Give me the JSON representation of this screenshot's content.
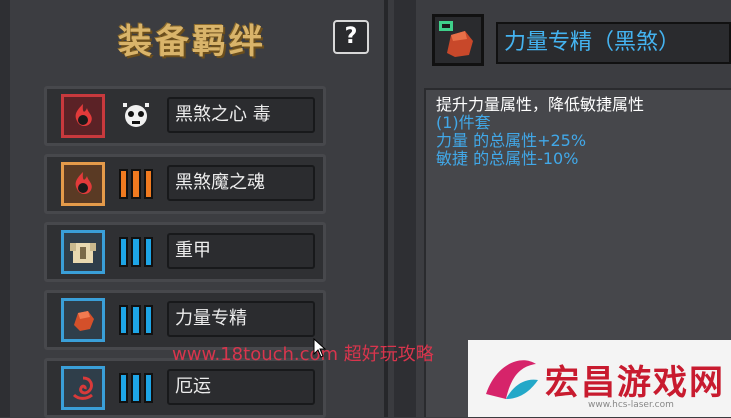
{
  "panel": {
    "title": "装备羁绊",
    "help_label": "?"
  },
  "sets": [
    {
      "name": "黑煞之心 毒",
      "count_color": "#d8d8d8",
      "icon": "black-flame-icon",
      "border_color": "#c8393d",
      "icon_bg": "#5b2226"
    },
    {
      "name": "黑煞魔之魂",
      "count_color": "#f07a20",
      "icon": "black-flame-icon",
      "border_color": "#e49a4a",
      "icon_bg": "#5a3a24"
    },
    {
      "name": "重甲",
      "count_color": "#1ea5e6",
      "icon": "heavy-armor-icon",
      "border_color": "#3a9fd8",
      "icon_bg": "#2f3e4a"
    },
    {
      "name": "力量专精",
      "count_color": "#1ea5e6",
      "icon": "strength-fist-icon",
      "border_color": "#3a9fd8",
      "icon_bg": "#2f3e4a"
    },
    {
      "name": "厄运",
      "count_color": "#1ea5e6",
      "icon": "doom-swirl-icon",
      "border_color": "#3a9fd8",
      "icon_bg": "#2f3e4a"
    }
  ],
  "detail": {
    "item_name": "力量专精（黑煞）",
    "item_icon": "strength-fist-icon",
    "description": "提升力量属性，降低敏捷属性",
    "set_count": "(1)件套",
    "stats": [
      "力量 的总属性+25%",
      "敏捷 的总属性-10%"
    ]
  },
  "watermark": {
    "url_text": "www.18touch.com 超好玩攻略",
    "logo_text": "宏昌游戏网",
    "logo_sub": "www.hcs-laser.com"
  },
  "colors": {
    "title_gold": "#d9b46a",
    "stat_blue": "#41a8e8",
    "name_blue": "#44b3f0"
  }
}
